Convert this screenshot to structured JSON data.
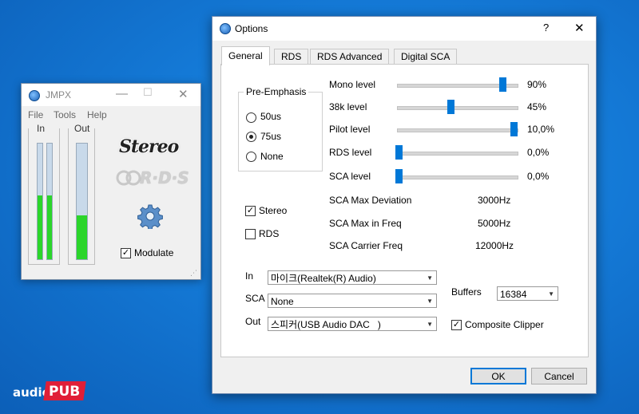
{
  "jmpx": {
    "title": "JMPX",
    "menu": [
      "File",
      "Tools",
      "Help"
    ],
    "in_label": "In",
    "out_label": "Out",
    "meters": {
      "in_left": 0.55,
      "in_right": 0.55,
      "out": 0.38
    },
    "stereo_logo": "Stereo",
    "rds_logo": "R·D·S",
    "modulate_label": "Modulate",
    "modulate_checked": true
  },
  "options": {
    "title": "Options",
    "help_glyph": "?",
    "close_glyph": "✕",
    "tabs": [
      "General",
      "RDS",
      "RDS Advanced",
      "Digital SCA"
    ],
    "active_tab": "General",
    "preemphasis": {
      "label": "Pre-Emphasis",
      "options": [
        "50us",
        "75us",
        "None"
      ],
      "selected": "75us"
    },
    "sliders": [
      {
        "label": "Mono level",
        "value": "90%",
        "position": 0.9
      },
      {
        "label": "38k level",
        "value": "45%",
        "position": 0.45
      },
      {
        "label": "Pilot level",
        "value": "10,0%",
        "position": 1.0
      },
      {
        "label": "RDS level",
        "value": "0,0%",
        "position": 0.0
      },
      {
        "label": "SCA level",
        "value": "0,0%",
        "position": 0.0
      }
    ],
    "sca_info": [
      {
        "label": "SCA Max Deviation",
        "value": "3000Hz"
      },
      {
        "label": "SCA Max in Freq",
        "value": "5000Hz"
      },
      {
        "label": "SCA Carrier Freq",
        "value": "12000Hz"
      }
    ],
    "stereo_label": "Stereo",
    "stereo_checked": true,
    "rds_label": "RDS",
    "rds_checked": false,
    "in_label": "In",
    "in_value": "마이크(Realtek(R) Audio)",
    "sca_label": "SCA",
    "sca_value": "None",
    "out_label": "Out",
    "out_value": "스피커(USB Audio DAC   )",
    "buffers_label": "Buffers",
    "buffers_value": "16384",
    "composite_clipper_label": "Composite Clipper",
    "composite_clipper_checked": true,
    "ok_label": "OK",
    "cancel_label": "Cancel"
  },
  "brand": {
    "audio": "audio",
    "pub": "PUB"
  },
  "colors": {
    "meter_green": "#2bd52b",
    "accent": "#0078d7",
    "brand_red": "#e01e37"
  }
}
